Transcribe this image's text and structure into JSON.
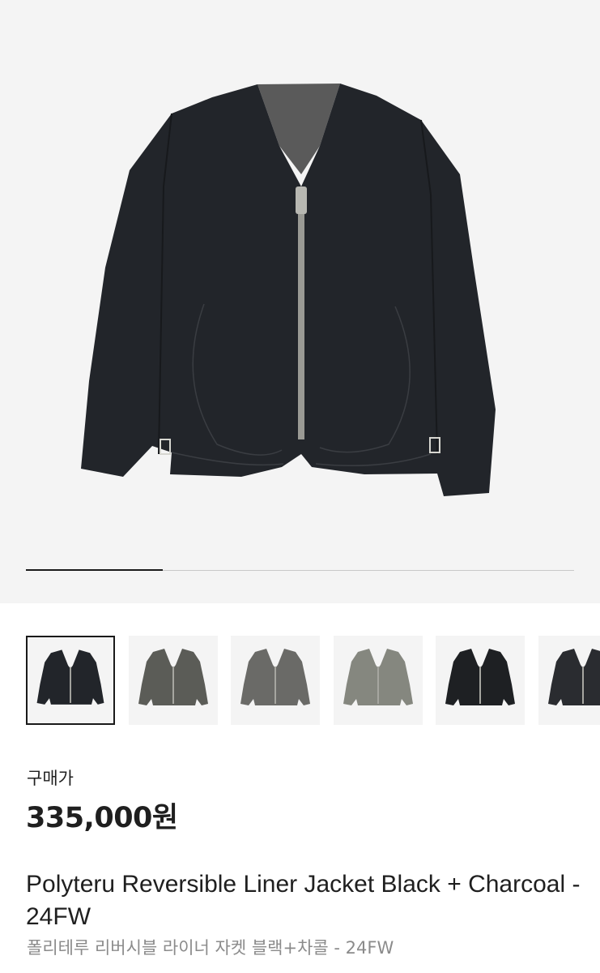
{
  "gallery": {
    "image_count": 6,
    "progress_fraction": 0.25,
    "thumbnails": [
      {
        "color": "Black",
        "fill": "#22252a",
        "selected": true
      },
      {
        "color": "Charcoal",
        "fill": "#5b5c57",
        "selected": false
      },
      {
        "color": "Charcoal",
        "fill": "#6a6a67",
        "selected": false
      },
      {
        "color": "Charcoal",
        "fill": "#85877f",
        "selected": false
      },
      {
        "color": "Black",
        "fill": "#1e2023",
        "selected": false
      },
      {
        "color": "Black",
        "fill": "#2a2c30",
        "selected": false
      }
    ]
  },
  "product": {
    "price_label": "구매가",
    "price": "335,000원",
    "title": "Polyteru Reversible Liner Jacket Black + Charcoal - 24FW",
    "subtitle": "폴리테루 리버시블 라이너 자켓 블랙+차콜 - 24FW"
  },
  "colors": {
    "hero_background": "#f4f4f4",
    "text_primary": "#1f1f1f",
    "text_secondary": "#8b8b8b",
    "jacket": "#22252a"
  }
}
